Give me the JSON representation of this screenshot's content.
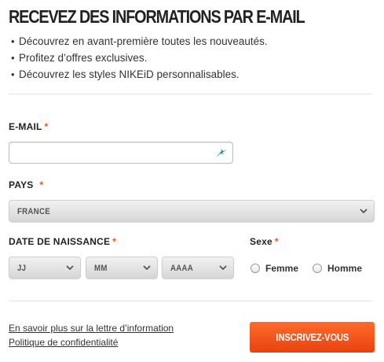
{
  "header": {
    "title": "RECEVEZ DES INFORMATIONS PAR E-MAIL",
    "benefits": [
      "Découvrez en avant-première toutes les nouveautés.",
      "Profitez d’offres exclusives.",
      "Découvrez les styles NIKEiD personnalisables."
    ],
    "bullet": "•"
  },
  "form": {
    "required_mark": "*",
    "email": {
      "label": "E-MAIL",
      "value": "",
      "placeholder": "",
      "icon": "nike-swoosh-icon"
    },
    "country": {
      "label": "PAYS",
      "selected": "FRANCE"
    },
    "birthdate": {
      "label": "DATE DE NAISSANCE",
      "day": "JJ",
      "month": "MM",
      "year": "AAAA"
    },
    "gender": {
      "label": "Sexe",
      "options": [
        "Femme",
        "Homme"
      ]
    }
  },
  "footer": {
    "links": [
      "En savoir plus sur la lettre d’information",
      "Politique de confidentialité"
    ],
    "submit_label": "INSCRIVEZ-VOUS"
  },
  "colors": {
    "accent": "#e8531f",
    "button": "#f25a1f",
    "text": "#333333"
  }
}
